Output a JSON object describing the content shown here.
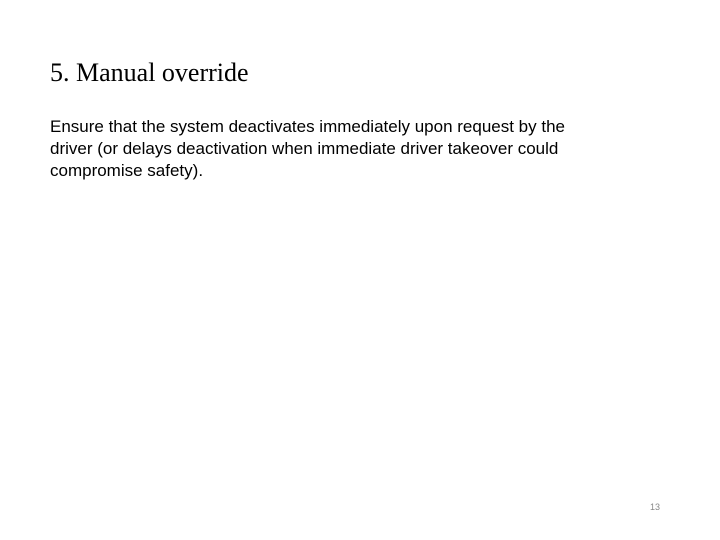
{
  "heading": "5. Manual override",
  "body": "Ensure that the system deactivates immediately upon request by the driver (or delays deactivation when immediate driver takeover could compromise safety).",
  "page_number": "13"
}
